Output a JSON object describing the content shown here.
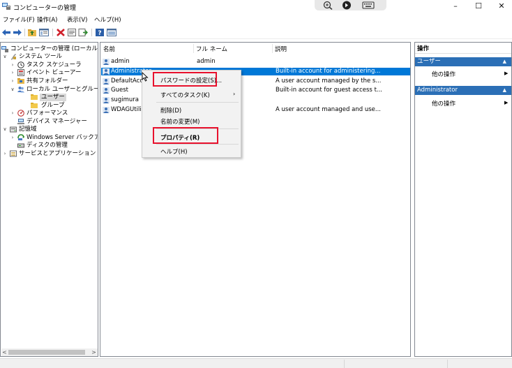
{
  "window": {
    "title": "コンピューターの管理",
    "controls": {
      "minimize": "–",
      "maximize": "☐",
      "close": "✕"
    }
  },
  "menubar": {
    "items": [
      {
        "label": "ファイル(F)"
      },
      {
        "label": "操作(A)"
      },
      {
        "label": "表示(V)"
      },
      {
        "label": "ヘルプ(H)"
      }
    ]
  },
  "tree": {
    "items": [
      {
        "label": "コンピューターの管理 (ローカル)",
        "icon": "computer-management-icon",
        "arrow": ""
      },
      {
        "label": "システム ツール",
        "icon": "tools-icon",
        "arrow": "∨"
      },
      {
        "label": "タスク スケジューラ",
        "icon": "clock-icon",
        "arrow": "›"
      },
      {
        "label": "イベント ビューアー",
        "icon": "event-viewer-icon",
        "arrow": "›"
      },
      {
        "label": "共有フォルダー",
        "icon": "shared-folder-icon",
        "arrow": "›"
      },
      {
        "label": "ローカル ユーザーとグループ",
        "icon": "users-groups-icon",
        "arrow": "∨"
      },
      {
        "label": "ユーザー",
        "icon": "folder-icon",
        "arrow": ""
      },
      {
        "label": "グループ",
        "icon": "folder-icon",
        "arrow": ""
      },
      {
        "label": "パフォーマンス",
        "icon": "performance-icon",
        "arrow": "›"
      },
      {
        "label": "デバイス マネージャー",
        "icon": "device-manager-icon",
        "arrow": ""
      },
      {
        "label": "記憶域",
        "icon": "storage-icon",
        "arrow": "∨"
      },
      {
        "label": "Windows Server バックア",
        "icon": "backup-icon",
        "arrow": "›"
      },
      {
        "label": "ディスクの管理",
        "icon": "disk-icon",
        "arrow": ""
      },
      {
        "label": "サービスとアプリケーション",
        "icon": "services-icon",
        "arrow": "›"
      }
    ]
  },
  "list": {
    "headers": {
      "name": "名前",
      "fullname": "フル ネーム",
      "description": "説明"
    },
    "rows": [
      {
        "name": "admin",
        "fullname": "admin",
        "description": ""
      },
      {
        "name": "Administrator",
        "fullname": "",
        "description": "Built-in account for administering..."
      },
      {
        "name": "DefaultAcc",
        "fullname": "",
        "description": "A user account managed by the s..."
      },
      {
        "name": "Guest",
        "fullname": "",
        "description": "Built-in account for guest access t..."
      },
      {
        "name": "sugimura",
        "fullname": "",
        "description": ""
      },
      {
        "name": "WDAGUtili",
        "fullname": "",
        "description": "A user account managed and use..."
      }
    ]
  },
  "context_menu": {
    "set_password": "パスワードの設定(S)...",
    "all_tasks": "すべてのタスク(K)",
    "all_tasks_arrow": "›",
    "delete": "削除(D)",
    "rename": "名前の変更(M)",
    "properties": "プロパティ(R)",
    "help": "ヘルプ(H)"
  },
  "actions": {
    "header": "操作",
    "sections": [
      {
        "title": "ユーザー",
        "arrow": "▲",
        "item": "他の操作",
        "item_arrow": "▶"
      },
      {
        "title": "Administrator",
        "arrow": "▲",
        "item": "他の操作",
        "item_arrow": "▶"
      }
    ]
  },
  "scroll": {
    "left": "<",
    "right": ">"
  },
  "colors": {
    "selection": "#0078d7",
    "highlight": "#e8112d",
    "section": "#2b6fb6"
  }
}
